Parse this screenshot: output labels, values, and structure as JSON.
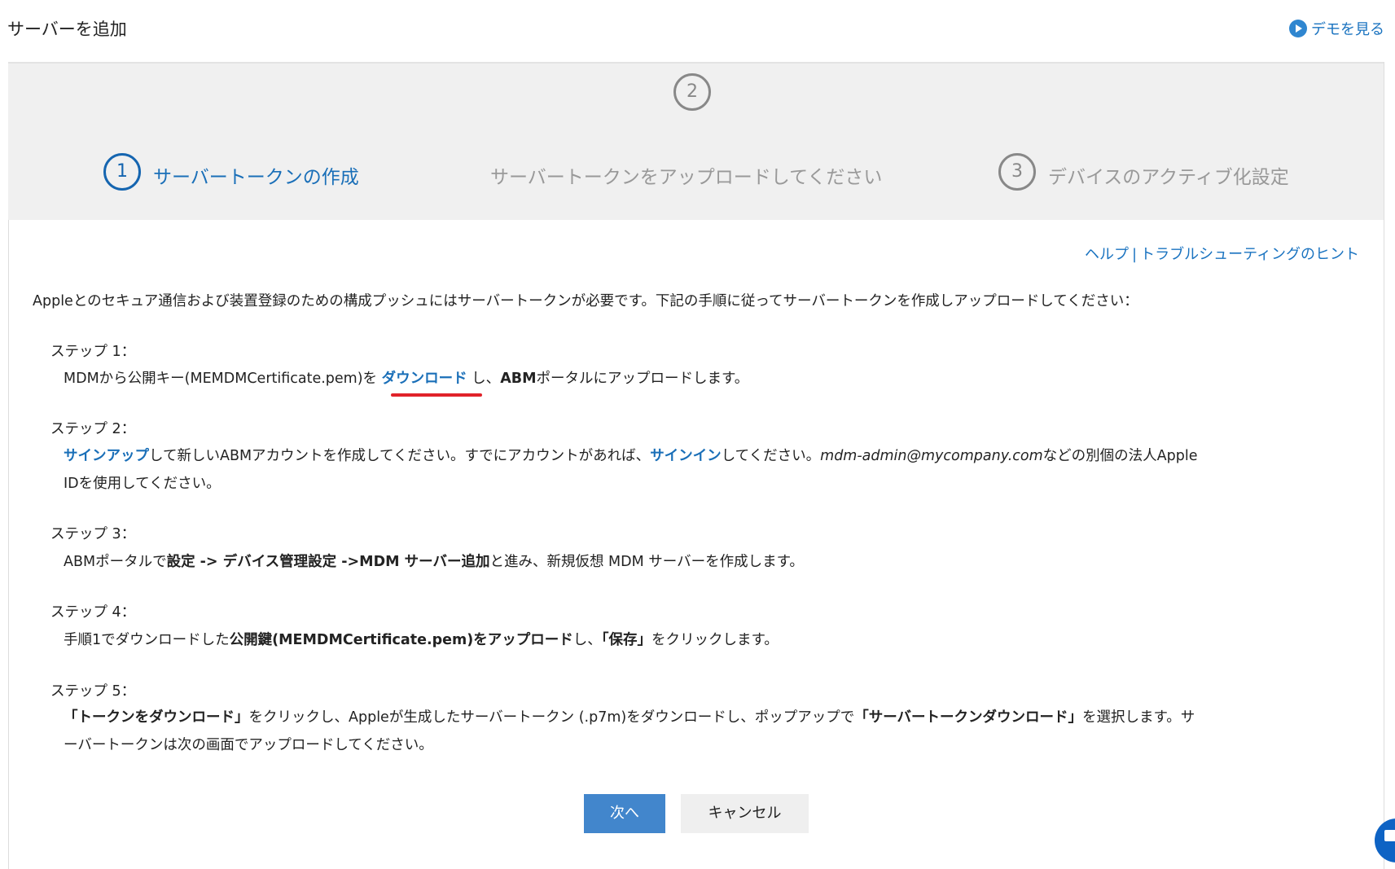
{
  "header": {
    "title": "サーバーを追加",
    "demo_link": "デモを見る",
    "demo_icon": "play-circle-icon"
  },
  "wizard": {
    "steps": [
      {
        "number": "1",
        "label": "サーバートークンの作成",
        "active": true
      },
      {
        "number": "2",
        "label": "サーバートークンをアップロードしてください",
        "active": false
      },
      {
        "number": "3",
        "label": "デバイスのアクティブ化設定",
        "active": false
      }
    ],
    "active_color": "#1565b0"
  },
  "help_links": {
    "help": "ヘルプ",
    "separator": "|",
    "troubleshooting": "トラブルシューティングのヒント"
  },
  "intro": "Appleとのセキュア通信および装置登録のための構成プッシュにはサーバートークンが必要です。下記の手順に従ってサーバートークンを作成しアップロードしてください：",
  "steps": {
    "s1": {
      "heading": "ステップ 1：",
      "a": "MDMから公開キー(MEMDMCertificate.pem)を ",
      "link": "ダウンロード",
      "b": " し、",
      "c": "ABM",
      "d": "ポータルにアップロードします。"
    },
    "s2": {
      "heading": "ステップ 2：",
      "link1": "サインアップ",
      "a": "して新しいABMアカウントを作成してください。すでにアカウントがあれば、",
      "link2": "サインイン",
      "b": "してください。",
      "email": "mdm-admin@mycompany.com",
      "c": "などの別個の法人Apple",
      "d": "IDを使用してください。"
    },
    "s3": {
      "heading": "ステップ 3：",
      "a": "ABMポータルで",
      "b1": "設定 -> デバイス管理設定 ->MDM サーバー追加",
      "c": "と進み、新規仮想 MDM サーバーを作成します。"
    },
    "s4": {
      "heading": "ステップ 4：",
      "a": "手順1でダウンロードした",
      "b1": "公開鍵(MEMDMCertificate.pem)をアップロード",
      "c": "し、",
      "b2": "「保存」",
      "d": "をクリックします。"
    },
    "s5": {
      "heading": "ステップ 5：",
      "b1": "「トークンをダウンロード」",
      "a": "をクリックし、Appleが生成したサーバートークン (.p7m)をダウンロードし、ポップアップで",
      "b2": "「サーバートークンダウンロード」",
      "c": "を選択します。サ",
      "d": "ーバートークンは次の画面でアップロードしてください。"
    }
  },
  "buttons": {
    "next": "次へ",
    "cancel": "キャンセル"
  },
  "chat_icon": "chat-bubble-icon"
}
